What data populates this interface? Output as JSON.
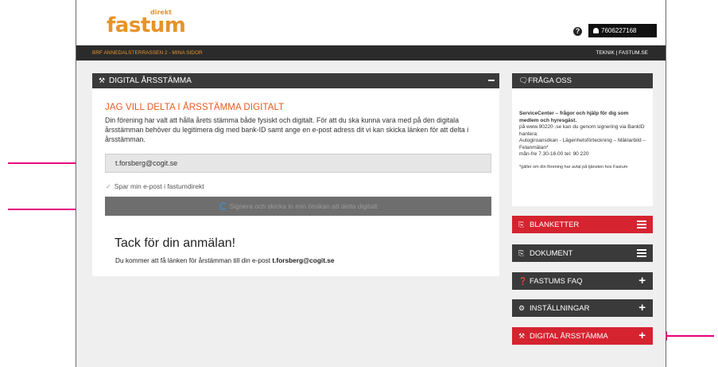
{
  "header": {
    "logo_text": "fastum",
    "logo_sup": "direkt",
    "help_icon": "?",
    "user_id": "7606227168"
  },
  "nav": {
    "breadcrumb": "BRF ANNEDALSTERRASSEN 2 - MINA SIDOR",
    "links": "TEKNIK  |  FASTUM.SE"
  },
  "main": {
    "header_title": "DIGITAL ÅRSSTÄMMA",
    "title": "JAG VILL DELTA I ÅRSSTÄMMA DIGITALT",
    "intro": "Din förening har valt att hålla årets stämma både fysiskt och digitalt. För att du ska kunna vara med på den digitala årsstämman behöver du legitimera dig med bank-ID samt ange en e-post adress dit vi kan skicka länken för att delta i årsstämman.",
    "email_value": "t.forsberg@cogit.se",
    "save_checkbox_label": "Spar min e-post i fastumdirekt",
    "submit_label": "Signera och skicka in min önskan att delta digitalt",
    "thanks_title": "Tack för din anmälan!",
    "thanks_text_prefix": "Du kommer att få länken för årstämman till din e-post ",
    "thanks_email": "t.forsberg@cogit.se"
  },
  "sidebar": {
    "contact_title": "FRÅGA OSS",
    "contact_lead": "ServiceCenter – frågor och hjälp för dig som medlem och hyresgäst.",
    "contact_line1": "på www.90220 .se kan du genom signering via BankID hantera:",
    "contact_line2": "Autogiroansökan - Lägenhetsförteckning – Mäklarbild – Felanmälan*",
    "contact_line3": "mån-fre 7.30-16.00 tel: 90 220",
    "contact_note": "*gäller om din förening har avtal på tjänsten hos Fastum",
    "items": [
      {
        "label": "BLANKETTER",
        "icon": "clipboard-icon",
        "action": "menu"
      },
      {
        "label": "DOKUMENT",
        "icon": "clipboard-icon",
        "action": "menu"
      },
      {
        "label": "FASTUMS FAQ",
        "icon": "question-icon",
        "action": "plus"
      },
      {
        "label": "INSTÄLLNINGAR",
        "icon": "gear-icon",
        "action": "plus"
      },
      {
        "label": "DIGITAL ÅRSSTÄMMA",
        "icon": "gavel-icon",
        "action": "plus"
      }
    ]
  },
  "colors": {
    "brand_orange": "#e8922a",
    "title_orange": "#e8581e",
    "red": "#d5232f",
    "dark": "#3a3a3a",
    "arrow_magenta": "#e6007e"
  }
}
